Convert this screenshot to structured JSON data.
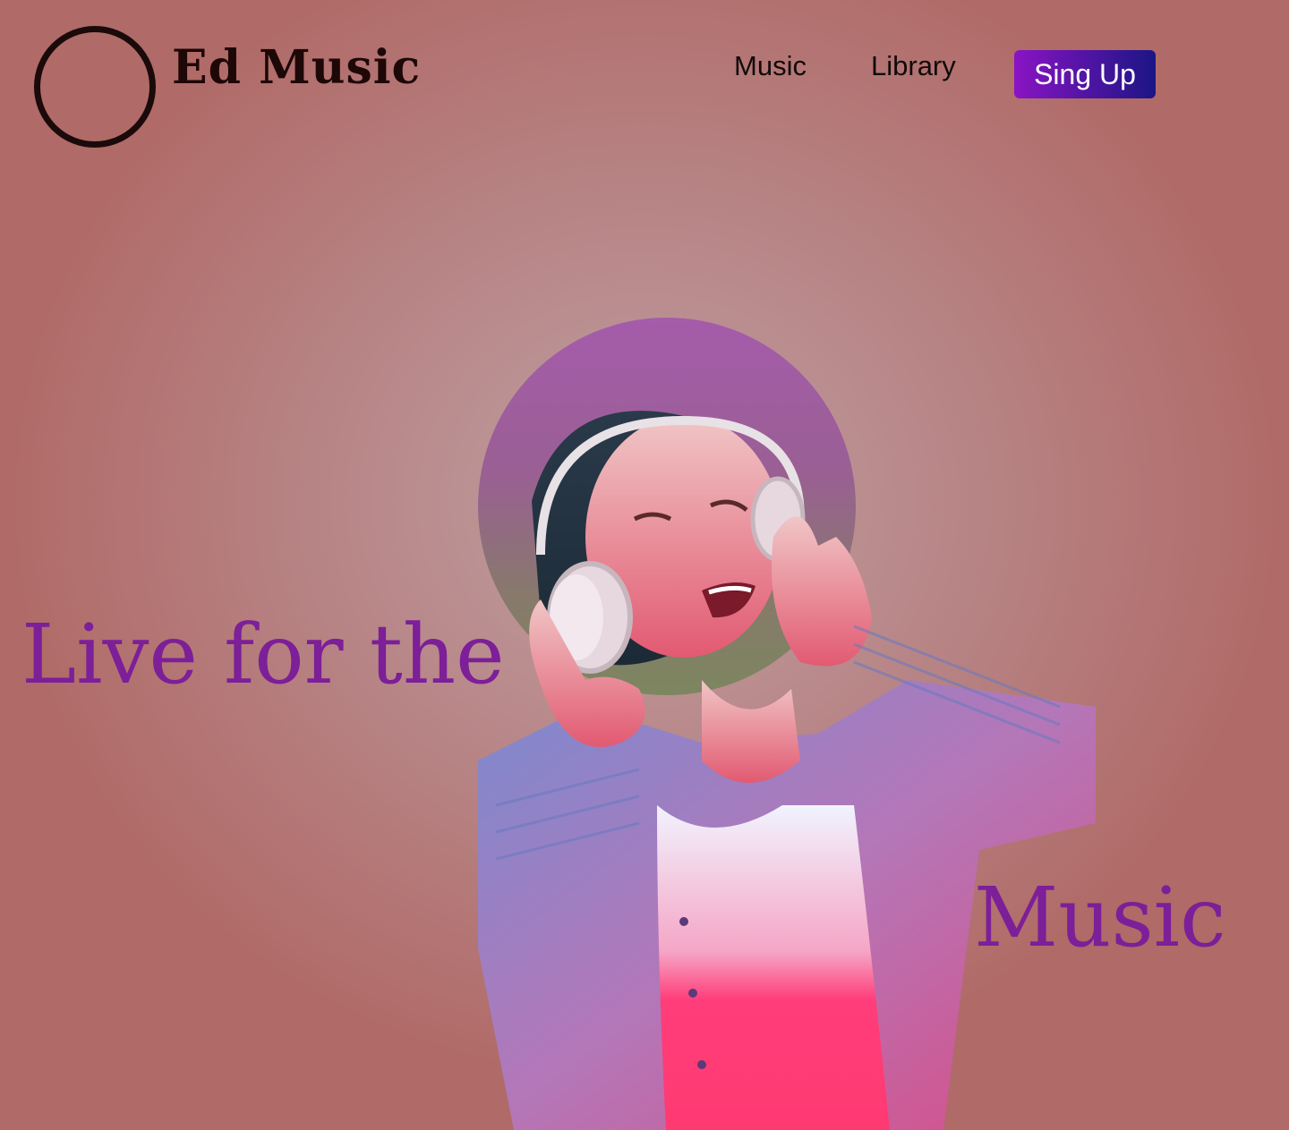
{
  "header": {
    "brand": "Ed Music",
    "nav": {
      "music": "Music",
      "library": "Library",
      "signup": "Sing Up"
    }
  },
  "hero": {
    "line1": "Live for the",
    "line2": "Music",
    "image_description": "woman-with-headphones"
  },
  "colors": {
    "background": "#b06a67",
    "accent_text": "#7c1f98",
    "button_start": "#8a14c4",
    "button_end": "#1b1585",
    "halo_top": "#a55cab"
  }
}
